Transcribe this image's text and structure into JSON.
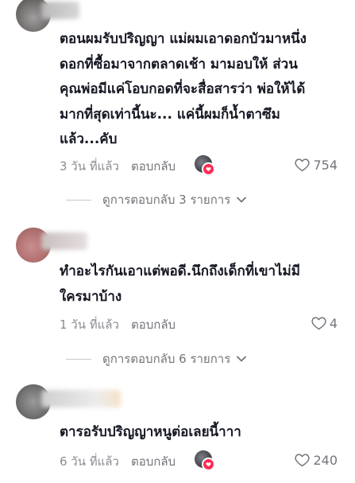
{
  "comments": [
    {
      "text": "ตอนผมรับปริญญา แม่ผมเอาดอกบัวมาหนึ่ง\nดอกที่ซื้อมาจากตลาดเช้า มามอบให้ ส่วน\nคุณพ่อมีแค่โอบกอดที่จะสื่อสารว่า พ่อให้ได้\nมากที่สุดเท่านี้นะ... แค่นี้ผมก็น้ำตาซึม\nแล้ว...คับ",
      "time": "3 วัน ที่แล้ว",
      "reply_label": "ตอบกลับ",
      "creator_liked": true,
      "likes": "754",
      "view_replies": "ดูการตอบกลับ 3 รายการ"
    },
    {
      "text": "ทำอะไรกันเอาแต่พอดี.นึกถึงเด็กที่เขาไม่มี\nใครมาบ้าง",
      "time": "1 วัน ที่แล้ว",
      "reply_label": "ตอบกลับ",
      "creator_liked": false,
      "likes": "4",
      "view_replies": "ดูการตอบกลับ 6 รายการ"
    },
    {
      "text": "ตารอรับปริญญาหนูต่อเลยนี้าาา",
      "time": "6 วัน ที่แล้ว",
      "reply_label": "ตอบกลับ",
      "creator_liked": true,
      "likes": "240"
    }
  ],
  "icons": {
    "like": "heart-outline-icon",
    "chevron": "chevron-down-icon",
    "creator_badge": "creator-liked-badge"
  },
  "colors": {
    "text_primary": "#161823",
    "text_secondary": "#8a8b91",
    "accent": "#fe2c55"
  }
}
